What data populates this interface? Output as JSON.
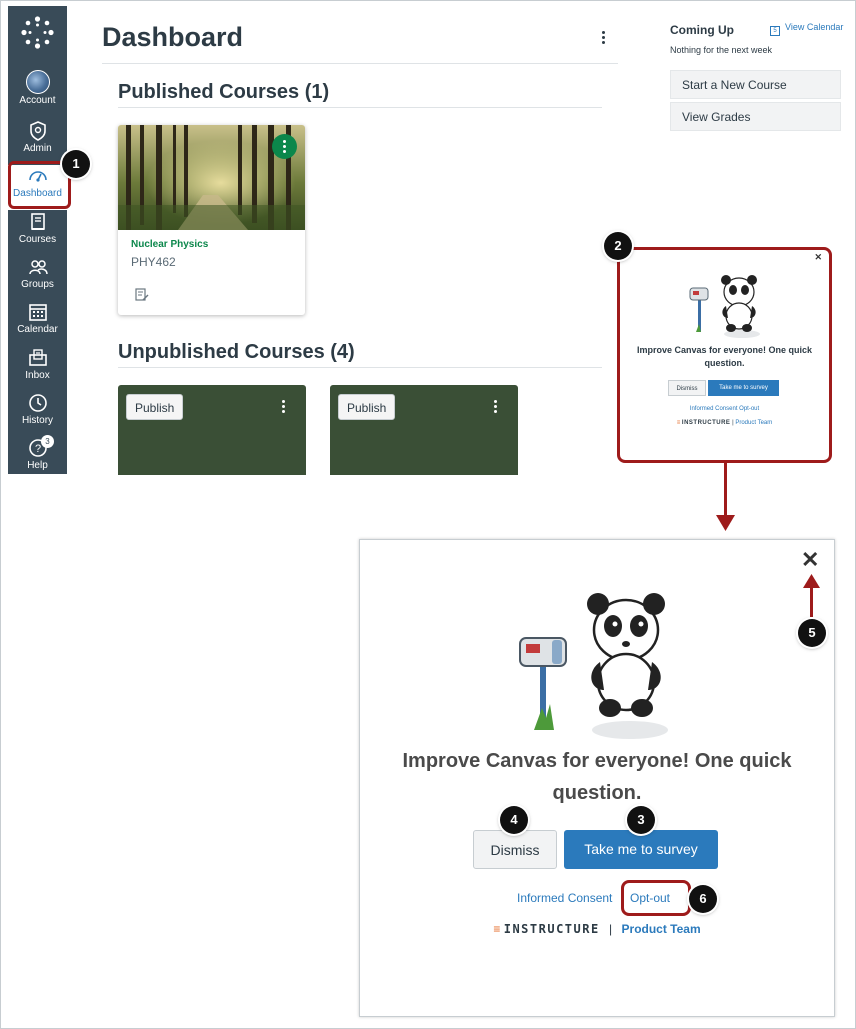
{
  "sidebar": {
    "items": [
      {
        "label": "Account"
      },
      {
        "label": "Admin"
      },
      {
        "label": "Dashboard"
      },
      {
        "label": "Courses"
      },
      {
        "label": "Groups"
      },
      {
        "label": "Calendar"
      },
      {
        "label": "Inbox"
      },
      {
        "label": "History"
      },
      {
        "label": "Help",
        "badge": "3"
      }
    ]
  },
  "dashboard": {
    "title": "Dashboard",
    "published_title": "Published Courses (1)",
    "unpublished_title": "Unpublished Courses (4)",
    "published_courses": [
      {
        "name": "Nuclear Physics",
        "code": "PHY462"
      }
    ],
    "unpublished_courses": [
      {
        "publish_label": "Publish"
      },
      {
        "publish_label": "Publish"
      }
    ]
  },
  "right": {
    "coming_up": "Coming Up",
    "view_calendar": "View Calendar",
    "nothing": "Nothing for the next week",
    "start_new_course": "Start a New Course",
    "view_grades": "View Grades"
  },
  "survey": {
    "question": "Improve Canvas for everyone! One quick question.",
    "dismiss": "Dismiss",
    "take": "Take me to survey",
    "informed_consent": "Informed Consent",
    "opt_out": "Opt-out",
    "brand": "INSTRUCTURE",
    "separator": "|",
    "product_team": "Product Team"
  },
  "markers": [
    "1",
    "2",
    "3",
    "4",
    "5",
    "6"
  ],
  "colors": {
    "sidebar_bg": "#394b58",
    "accent_blue": "#2b7abc",
    "course_green": "#0b874b",
    "highlight_red": "#9e1b1b"
  }
}
